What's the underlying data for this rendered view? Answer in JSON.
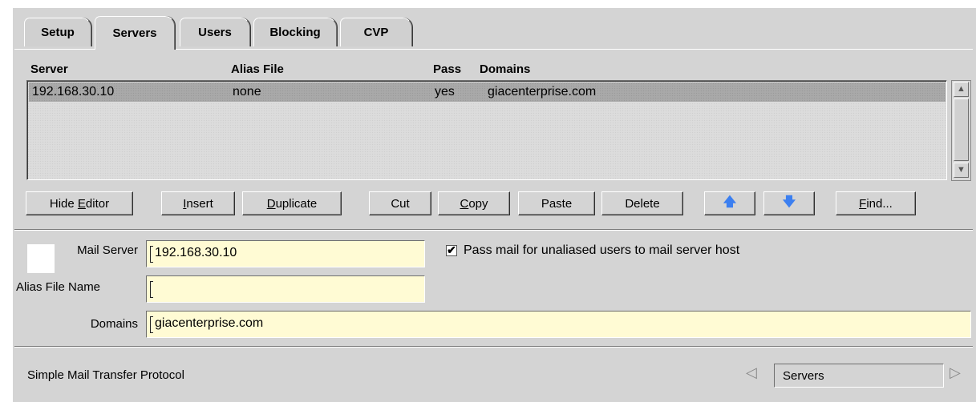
{
  "tabs": [
    {
      "label": "Setup",
      "active": false
    },
    {
      "label": "Servers",
      "active": true
    },
    {
      "label": "Users",
      "active": false
    },
    {
      "label": "Blocking",
      "active": false
    },
    {
      "label": "CVP",
      "active": false
    }
  ],
  "table": {
    "columns": [
      "Server",
      "Alias File",
      "Pass",
      "Domains"
    ],
    "rows": [
      {
        "server": "192.168.30.10",
        "alias": "none",
        "pass": "yes",
        "domains": "giacenterprise.com"
      }
    ]
  },
  "buttons": {
    "hide_editor_pre": "Hide ",
    "hide_editor_ul": "E",
    "hide_editor_post": "ditor",
    "insert_ul": "I",
    "insert_post": "nsert",
    "duplicate_ul": "D",
    "duplicate_post": "uplicate",
    "cut": "Cut",
    "copy_ul": "C",
    "copy_post": "opy",
    "paste": "Paste",
    "delete": "Delete",
    "up": "🡅",
    "down": "🡇",
    "find_ul": "F",
    "find_post": "ind..."
  },
  "form": {
    "mail_server_label": "Mail Server",
    "mail_server_value": "192.168.30.10",
    "alias_label": "Alias File Name",
    "alias_value": "",
    "domains_label": "Domains",
    "domains_value": "giacenterprise.com",
    "pass_mail_checked": true,
    "pass_mail_label": "Pass mail for unaliased users to mail server host"
  },
  "footer": {
    "protocol": "Simple Mail Transfer Protocol",
    "nav_value": "Servers",
    "check_glyph": "✔",
    "prev_glyph": "◁",
    "next_glyph": "▷",
    "scroll_up_glyph": "▲",
    "scroll_down_glyph": "▼"
  }
}
